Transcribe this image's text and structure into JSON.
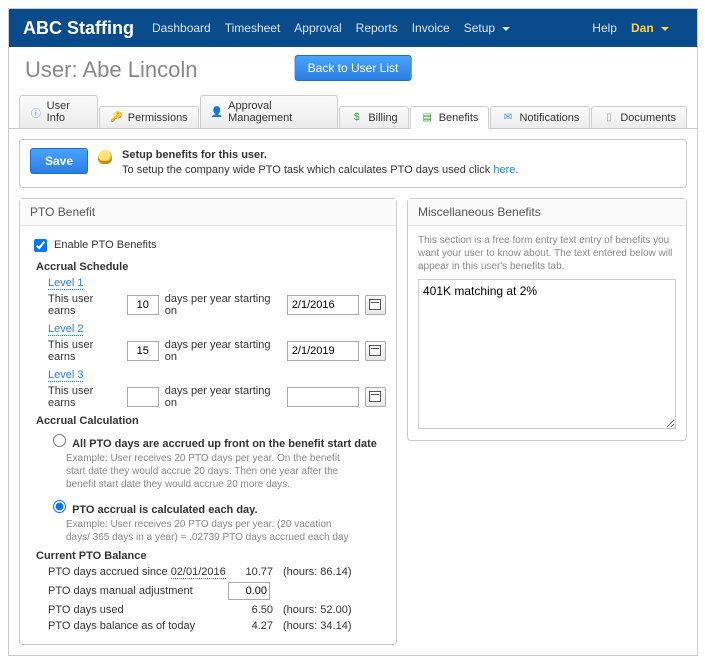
{
  "brand": "ABC Staffing",
  "nav": {
    "items": [
      "Dashboard",
      "Timesheet",
      "Approval",
      "Reports",
      "Invoice",
      "Setup"
    ],
    "help": "Help",
    "user": "Dan"
  },
  "header": {
    "prefix": "User:",
    "username": "Abe Lincoln",
    "back_btn": "Back to User List"
  },
  "tabs": [
    {
      "label": "User Info"
    },
    {
      "label": "Permissions"
    },
    {
      "label": "Approval Management"
    },
    {
      "label": "Billing"
    },
    {
      "label": "Benefits",
      "active": true
    },
    {
      "label": "Notifications"
    },
    {
      "label": "Documents"
    }
  ],
  "notice": {
    "save": "Save",
    "line1": "Setup benefits for this user.",
    "line2_a": "To setup the company wide PTO task which calculates PTO days used click ",
    "line2_link": "here",
    "line2_b": "."
  },
  "pto": {
    "title": "PTO Benefit",
    "enable_label": "Enable PTO Benefits",
    "enable_checked": true,
    "accrual_schedule_label": "Accrual Schedule",
    "levels": [
      {
        "name": "Level 1",
        "earns": "10",
        "date": "2/1/2016"
      },
      {
        "name": "Level 2",
        "earns": "15",
        "date": "2/1/2019"
      },
      {
        "name": "Level 3",
        "earns": "",
        "date": ""
      }
    ],
    "earns_prefix": "This user earns",
    "earns_mid": "days per year starting on",
    "accrual_calc_label": "Accrual Calculation",
    "radio1_label": "All PTO days are accrued up front on the benefit start date",
    "radio1_sub": "Example: User receives 20 PTO days per year. On the benefit start date they would accrue 20 days. Then one year after the benefit start date they would accrue 20 more days.",
    "radio2_label": "PTO accrual is calculated each day.",
    "radio2_sub": "Example: User receives 20 PTO days per year. (20 vacation days/ 365 days in a year) = .02739 PTO days accrued each day",
    "radio_selected": 2,
    "balance_label": "Current PTO Balance",
    "balance": {
      "accrued_prefix": "PTO days accrued since ",
      "accrued_date": "02/01/2016",
      "accrued_val": "10.77",
      "accrued_hours": "(hours: 86.14)",
      "manual_label": "PTO days manual adjustment",
      "manual_val": "0.00",
      "used_label": "PTO days used",
      "used_val": "6.50",
      "used_hours": "(hours: 52.00)",
      "bal_label": "PTO days balance as of today",
      "bal_val": "4.27",
      "bal_hours": "(hours: 34.14)"
    }
  },
  "misc": {
    "title": "Miscellaneous Benefits",
    "help": "This section is a free form entry text entry of benefits you want your user to know about. The text entered below will appear in this user's benefits tab.",
    "text": "401K matching at 2%"
  }
}
